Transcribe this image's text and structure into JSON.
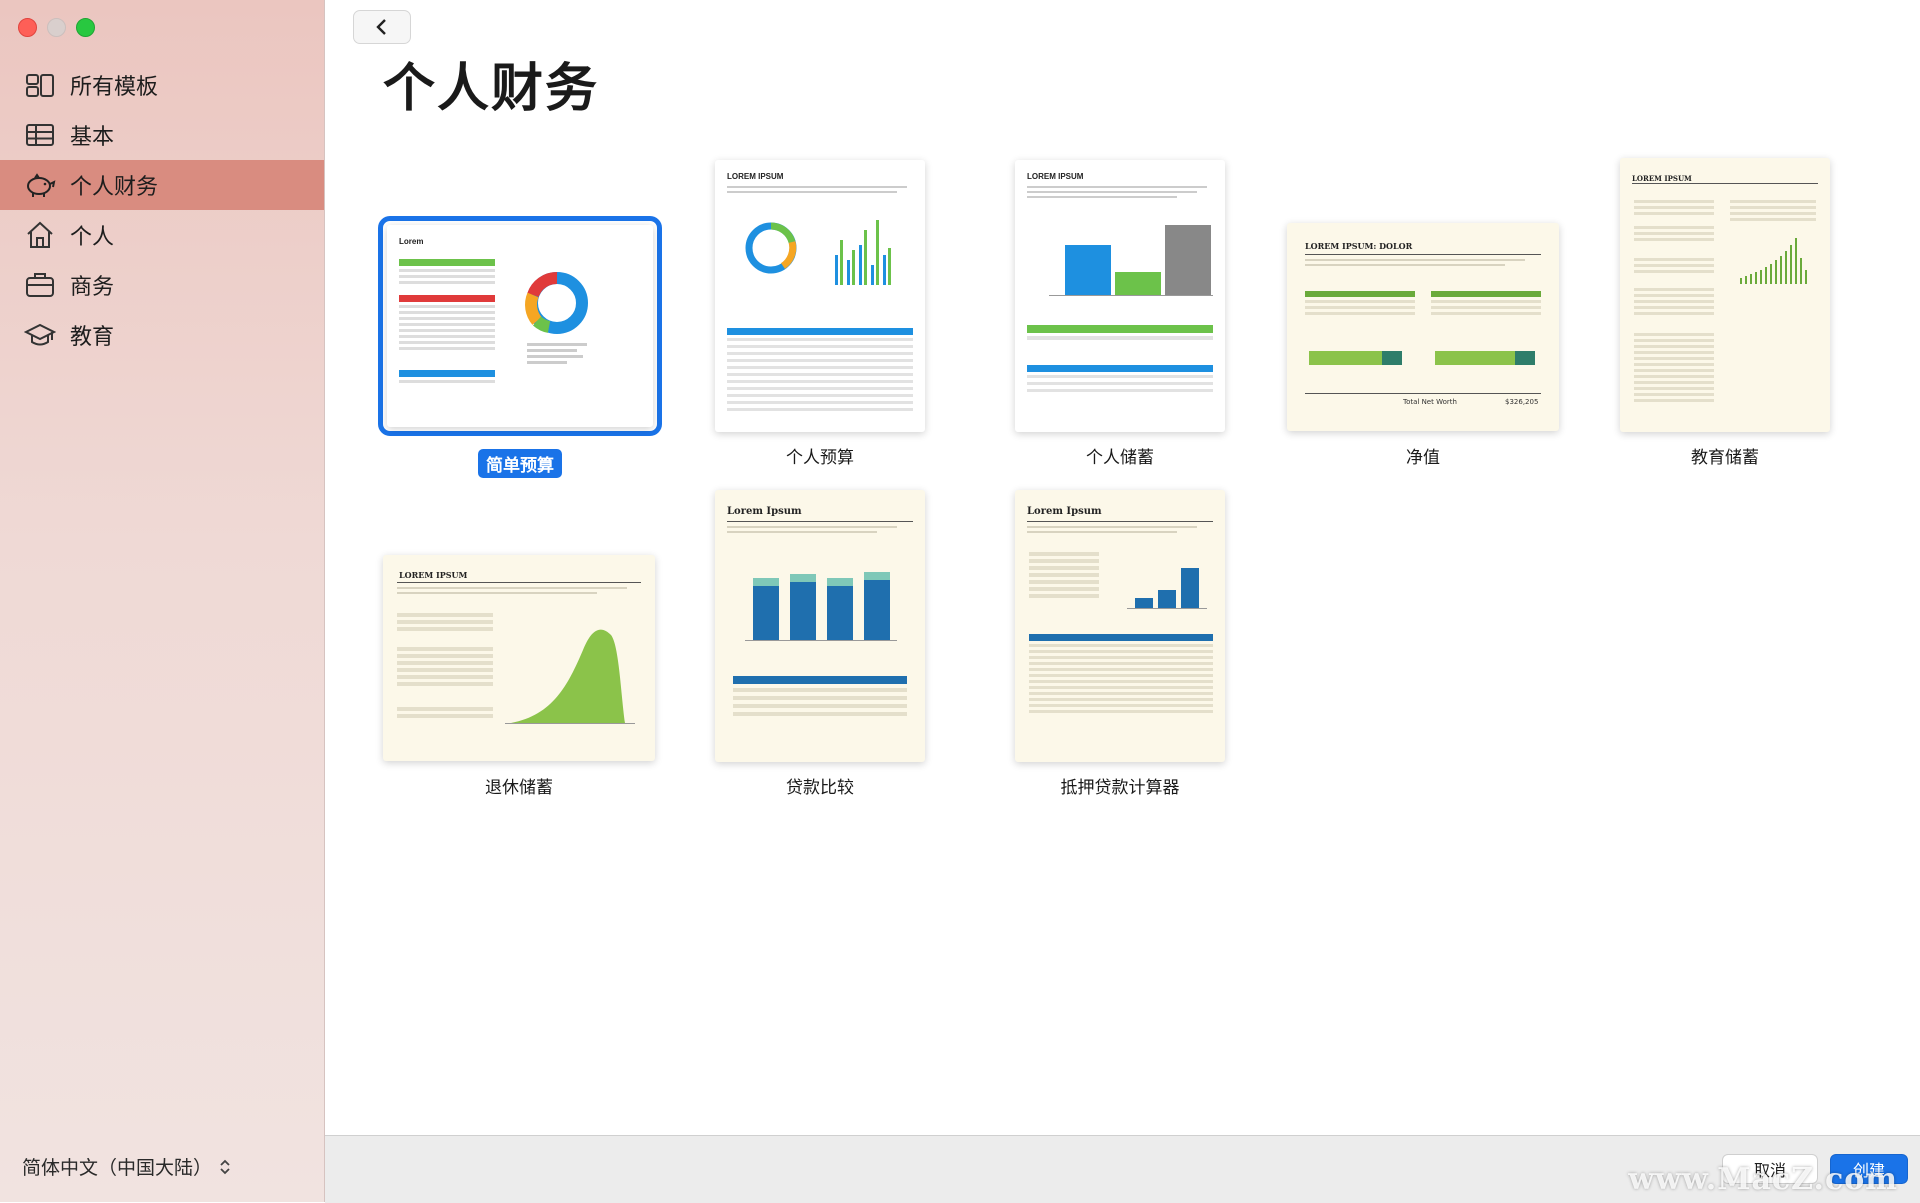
{
  "sidebar": {
    "items": [
      {
        "label": "所有模板",
        "icon": "all-templates-icon"
      },
      {
        "label": "基本",
        "icon": "table-icon"
      },
      {
        "label": "个人财务",
        "icon": "piggy-bank-icon"
      },
      {
        "label": "个人",
        "icon": "home-icon"
      },
      {
        "label": "商务",
        "icon": "briefcase-icon"
      },
      {
        "label": "教育",
        "icon": "graduation-cap-icon"
      }
    ],
    "active_index": 2,
    "language": "简体中文（中国大陆）"
  },
  "main": {
    "title": "个人财务",
    "templates": [
      {
        "label": "简单预算",
        "selected": true,
        "preview_title": "Lorem"
      },
      {
        "label": "个人预算",
        "selected": false,
        "preview_title": "LOREM IPSUM"
      },
      {
        "label": "个人储蓄",
        "selected": false,
        "preview_title": "LOREM IPSUM"
      },
      {
        "label": "净值",
        "selected": false,
        "preview_title": "LOREM IPSUM: DOLOR",
        "preview_footer": "Total Net Worth",
        "preview_value": "$326,205"
      },
      {
        "label": "教育储蓄",
        "selected": false,
        "preview_title": "LOREM IPSUM"
      },
      {
        "label": "退休储蓄",
        "selected": false,
        "preview_title": "LOREM IPSUM"
      },
      {
        "label": "贷款比较",
        "selected": false,
        "preview_title": "Lorem Ipsum"
      },
      {
        "label": "抵押贷款计算器",
        "selected": false,
        "preview_title": "Lorem Ipsum"
      }
    ]
  },
  "footer": {
    "cancel_label": "取消",
    "create_label": "创建"
  },
  "watermark": "www.MacZ.com",
  "colors": {
    "accent": "#1a73e8",
    "sidebar_active": "#d98c80",
    "sidebar_bg": "#ebc6c0"
  }
}
